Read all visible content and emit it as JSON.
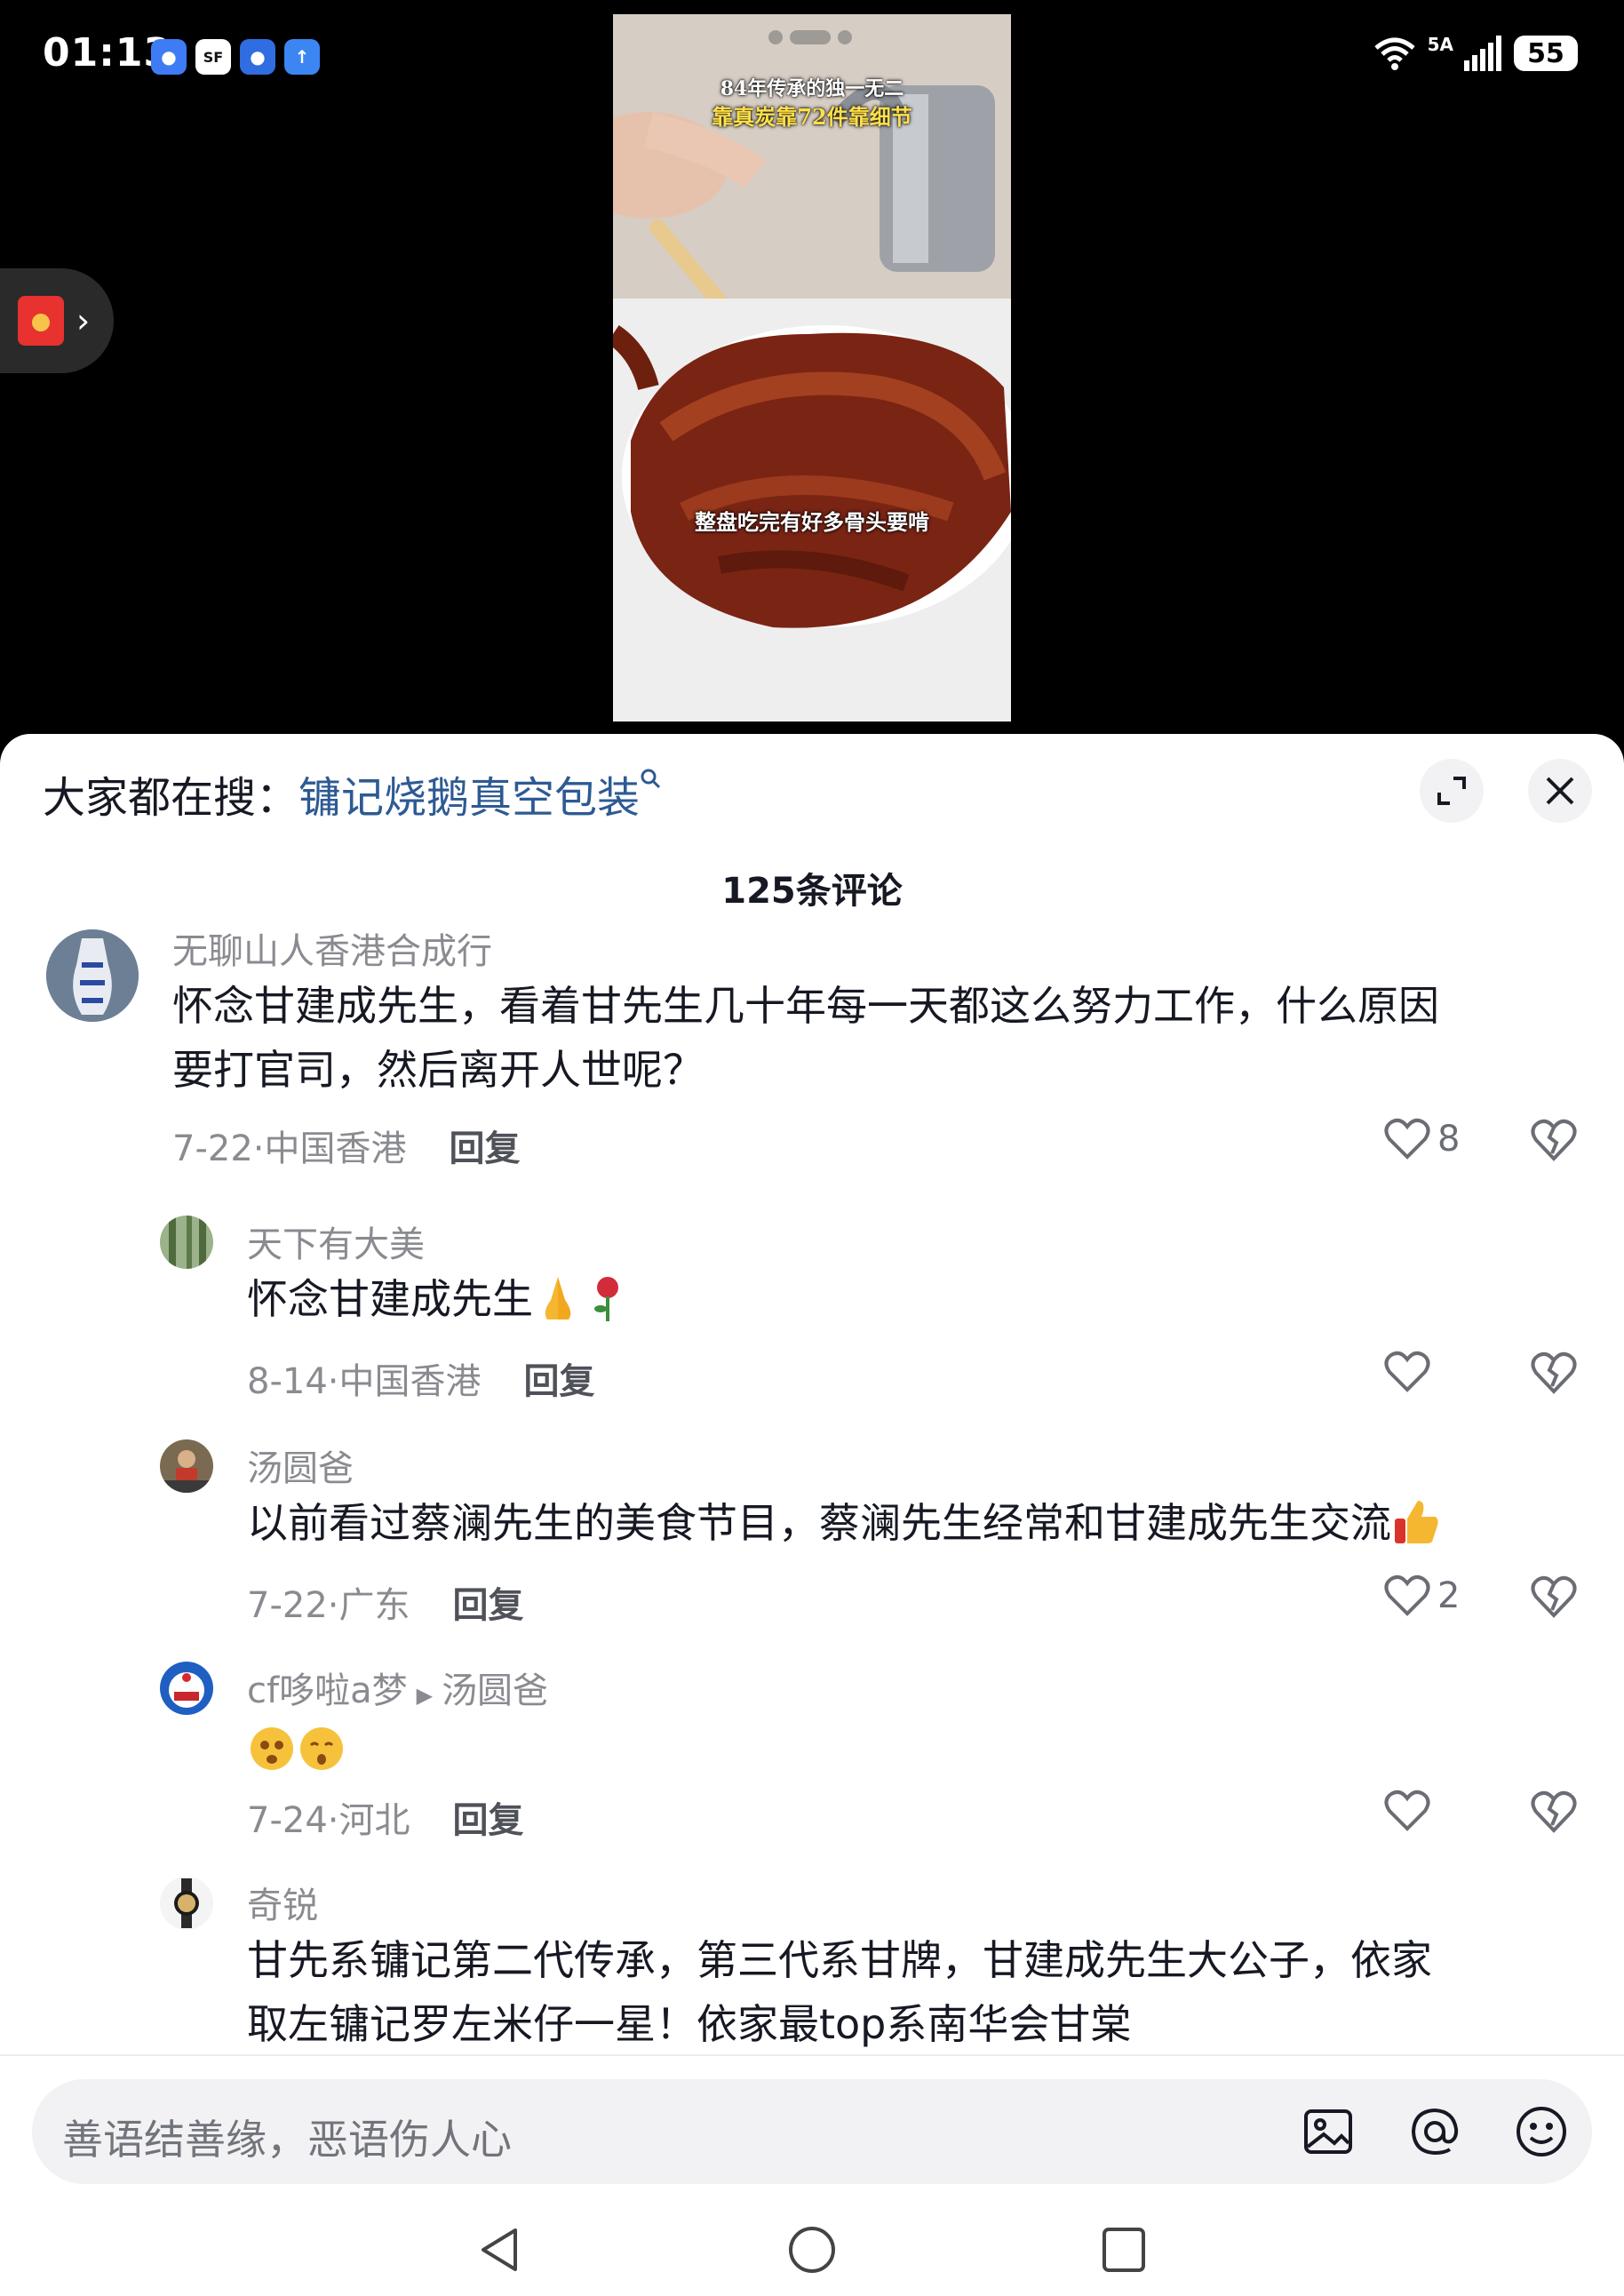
{
  "status_bar": {
    "time": "01:13",
    "network": "5A",
    "battery": "55"
  },
  "video": {
    "caption_line1": "84年传承的独一无二",
    "caption_line2": "靠真炭靠72件靠细节",
    "caption_bottom": "整盘吃完有好多骨头要啃"
  },
  "search": {
    "prefix": "大家都在搜：",
    "term": "镛记烧鹅真空包装"
  },
  "comments_title": "125条评论",
  "comments": [
    {
      "name": "无聊山人香港合成行",
      "text_line1": "怀念甘建成先生，看着甘先生几十年每一天都这么努力工作，什么原因",
      "text_line2": "要打官司，然后离开人世呢？",
      "date": "7-22·中国香港",
      "reply": "回复",
      "likes": "8"
    },
    {
      "name": "天下有大美",
      "text": "怀念甘建成先生",
      "date": "8-14·中国香港",
      "reply": "回复",
      "likes": ""
    },
    {
      "name": "汤圆爸",
      "text": "以前看过蔡澜先生的美食节目，蔡澜先生经常和甘建成先生交流",
      "date": "7-22·广东",
      "reply": "回复",
      "likes": "2"
    },
    {
      "name": "cf哆啦a梦",
      "reply_to": "汤圆爸",
      "date": "7-24·河北",
      "reply": "回复",
      "likes": ""
    },
    {
      "name": "奇锐",
      "text_line1": "甘先系镛记第二代传承，第三代系甘牌，甘建成先生大公子，依家",
      "text_line2": "取左镛记罗左米仔一星！依家最top系南华会甘棠"
    }
  ],
  "input": {
    "placeholder": "善语结善缘，恶语伤人心"
  },
  "colors": {
    "accent_link": "#2d5a93",
    "sheet_bg": "#ffffff",
    "muted_text": "#8a8b91"
  }
}
